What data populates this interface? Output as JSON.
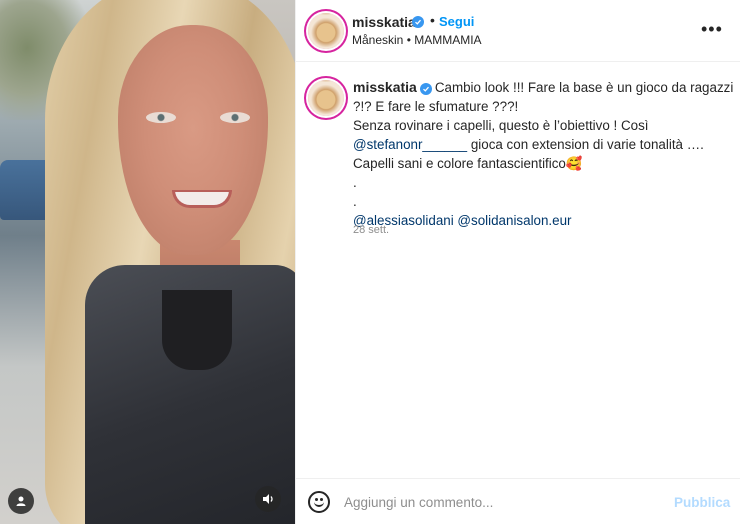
{
  "post": {
    "author": "misskatia",
    "follow_label": "Segui",
    "separator": "•",
    "audio": "Måneskin • MAMMAMIA",
    "more_label": "•••"
  },
  "caption": {
    "author": "misskatia",
    "line1": "Cambio look !!! Fare la base è un gioco da ragazzi",
    "line2": "?!? E fare le sfumature ???!",
    "line3": "Senza rovinare i capelli, questo è l’obiettivo ! Così",
    "mention1": "@stefanonr______",
    "line4_rest": " gioca con extension di varie tonalità ….",
    "line5": "Capelli sani e colore fantascientifico🥰",
    "dot1": ".",
    "dot2": ".",
    "mention2": "@alessiasolidani",
    "mention3": "@solidanisalon.eur",
    "timestamp": "28 sett."
  },
  "comment": {
    "placeholder": "Aggiungi un commento...",
    "publish_label": "Pubblica"
  },
  "colors": {
    "accent": "#0095f6",
    "verified": "#3897f0",
    "mention": "#00376b",
    "publish_disabled": "#b3dbff"
  },
  "icons": [
    "verified-badge-icon",
    "more-options-icon",
    "emoji-icon",
    "user-tag-icon",
    "sound-icon"
  ]
}
